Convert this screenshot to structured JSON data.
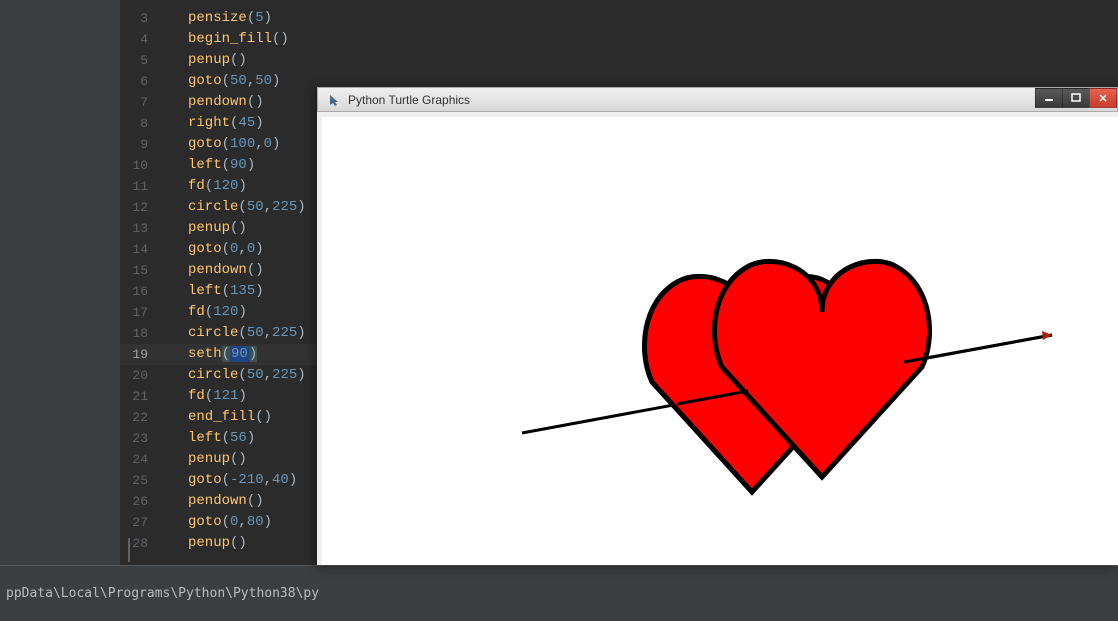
{
  "editor": {
    "lines": [
      {
        "n": 3,
        "fn": "pensize",
        "args": "5"
      },
      {
        "n": 4,
        "fn": "begin_fill",
        "args": ""
      },
      {
        "n": 5,
        "fn": "penup",
        "args": ""
      },
      {
        "n": 6,
        "fn": "goto",
        "args": "50,50"
      },
      {
        "n": 7,
        "fn": "pendown",
        "args": ""
      },
      {
        "n": 8,
        "fn": "right",
        "args": "45"
      },
      {
        "n": 9,
        "fn": "goto",
        "args": "100,0"
      },
      {
        "n": 10,
        "fn": "left",
        "args": "90"
      },
      {
        "n": 11,
        "fn": "fd",
        "args": "120"
      },
      {
        "n": 12,
        "fn": "circle",
        "args": "50,225"
      },
      {
        "n": 13,
        "fn": "penup",
        "args": ""
      },
      {
        "n": 14,
        "fn": "goto",
        "args": "0,0"
      },
      {
        "n": 15,
        "fn": "pendown",
        "args": ""
      },
      {
        "n": 16,
        "fn": "left",
        "args": "135"
      },
      {
        "n": 17,
        "fn": "fd",
        "args": "120"
      },
      {
        "n": 18,
        "fn": "circle",
        "args": "50,225"
      },
      {
        "n": 19,
        "fn": "seth",
        "args": "90",
        "current": true
      },
      {
        "n": 20,
        "fn": "circle",
        "args": "50,225"
      },
      {
        "n": 21,
        "fn": "fd",
        "args": "121"
      },
      {
        "n": 22,
        "fn": "end_fill",
        "args": ""
      },
      {
        "n": 23,
        "fn": "left",
        "args": "56"
      },
      {
        "n": 24,
        "fn": "penup",
        "args": ""
      },
      {
        "n": 25,
        "fn": "goto",
        "args": "-210,40"
      },
      {
        "n": 26,
        "fn": "pendown",
        "args": ""
      },
      {
        "n": 27,
        "fn": "goto",
        "args": "0,80"
      },
      {
        "n": 28,
        "fn": "penup",
        "args": ""
      }
    ]
  },
  "statusbar": {
    "path": "ppData\\Local\\Programs\\Python\\Python38\\py"
  },
  "turtle_window": {
    "title": "Python Turtle Graphics",
    "controls": {
      "min": "—",
      "max": "▢",
      "close": "X"
    }
  }
}
